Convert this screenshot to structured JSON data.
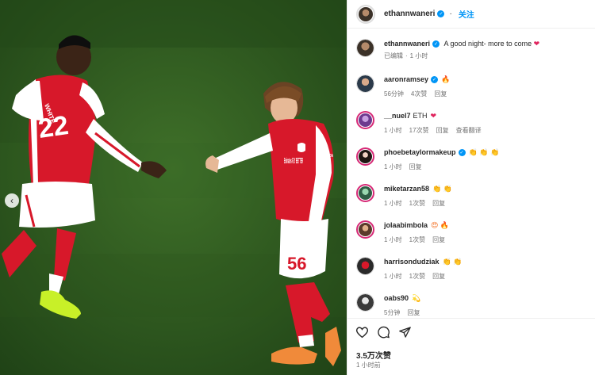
{
  "header": {
    "username": "ethannwaneri",
    "verified_mark": "✓",
    "follow_label": "关注",
    "more_label": "…"
  },
  "caption": {
    "username": "ethannwaneri",
    "text": "A good night- more to come",
    "emoji": "❤",
    "edited": "已编辑",
    "separator": "·",
    "time": "1 小时"
  },
  "comments": [
    {
      "username": "aaronramsey",
      "verified": true,
      "text": "",
      "emoji": "🔥",
      "emoji_class": "fire",
      "time": "56分钟",
      "likes": "4次赞",
      "reply": "回复",
      "translate": ""
    },
    {
      "username": "__nuel7",
      "verified": false,
      "text": "ETH",
      "emoji": "❤",
      "emoji_class": "heart",
      "time": "1 小时",
      "likes": "17次赞",
      "reply": "回复",
      "translate": "查看翻译"
    },
    {
      "username": "phoebetaylormakeup",
      "verified": true,
      "text": "",
      "emoji": "👏 👏 👏",
      "emoji_class": "clap",
      "time": "1 小时",
      "likes": "",
      "reply": "回复",
      "translate": ""
    },
    {
      "username": "miketarzan58",
      "verified": false,
      "text": "",
      "emoji": "👏 👏",
      "emoji_class": "clap",
      "time": "1 小时",
      "likes": "1次赞",
      "reply": "回复",
      "translate": ""
    },
    {
      "username": "jolaabimbola",
      "verified": false,
      "text": "",
      "emoji": "😍 🔥",
      "emoji_class": "fire",
      "time": "1 小时",
      "likes": "1次赞",
      "reply": "回复",
      "translate": ""
    },
    {
      "username": "harrisondudziak",
      "verified": false,
      "text": "",
      "emoji": "👏 👏",
      "emoji_class": "clap",
      "time": "1 小时",
      "likes": "1次赞",
      "reply": "回复",
      "translate": ""
    },
    {
      "username": "oabs90",
      "verified": false,
      "text": "",
      "emoji": "💫",
      "emoji_class": "clap",
      "time": "5分钟",
      "likes": "",
      "reply": "回复",
      "translate": ""
    }
  ],
  "footer": {
    "likes": "3.5万次赞",
    "time": "1 小时前"
  },
  "media": {
    "prev_arrow": "‹",
    "player1_number": "22",
    "player1_name": "WHITE",
    "player2_number": "56",
    "player2_sponsor": "Emirates FLY BETTER",
    "player2_sleeve": "VISIT RWANDA"
  },
  "colors": {
    "accent": "#0095f6",
    "pitch": "#2f5a22",
    "kit_red": "#d7182a"
  }
}
